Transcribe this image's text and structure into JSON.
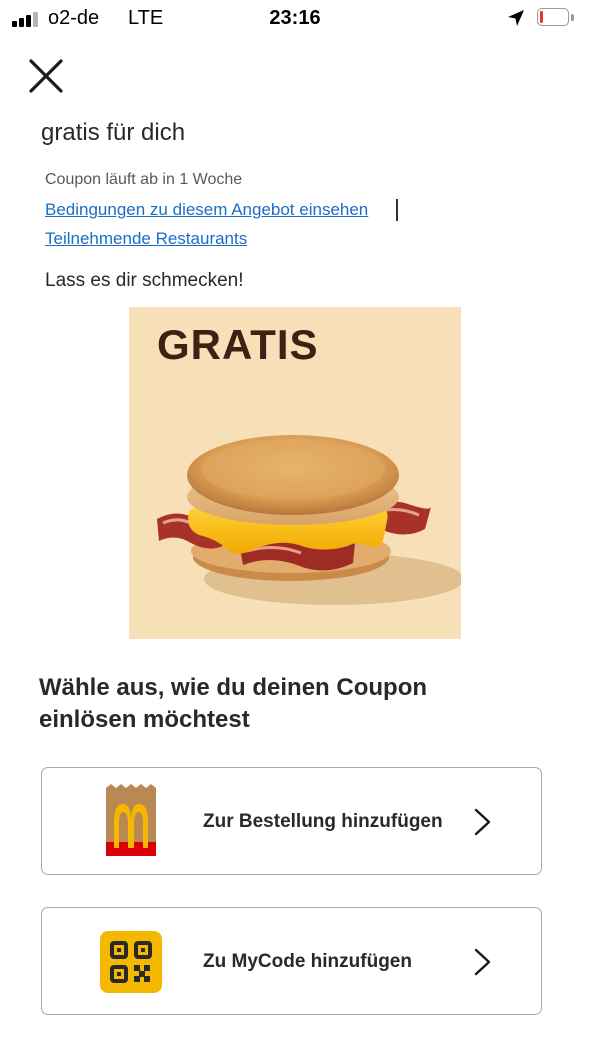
{
  "status_bar": {
    "carrier": "o2-de",
    "network": "LTE",
    "time": "23:16",
    "battery_level_percent": 10,
    "battery_color": "#e8322f"
  },
  "header": {
    "close_icon": "close-icon"
  },
  "coupon": {
    "title": "gratis für dich",
    "expiry": "Coupon läuft ab in 1 Woche",
    "terms_link": "Bedingungen zu diesem Angebot einsehen",
    "restaurants_link": "Teilnehmende Restaurants",
    "tagline": "Lass es dir schmecken!",
    "image": {
      "label": "GRATIS",
      "background_color": "#f7e0b8",
      "text_color": "#3f2113"
    }
  },
  "redeem": {
    "headline": "Wähle aus, wie du deinen Coupon einlösen möchtest",
    "options": [
      {
        "label": "Zur Bestellung hinzufügen",
        "icon": "mcdonalds-bag-icon"
      },
      {
        "label": "Zu MyCode hinzufügen",
        "icon": "qr-code-icon"
      }
    ]
  },
  "colors": {
    "link": "#1a6ec6",
    "mcdonalds_yellow": "#f5b800",
    "mcdonalds_red": "#db0007"
  }
}
